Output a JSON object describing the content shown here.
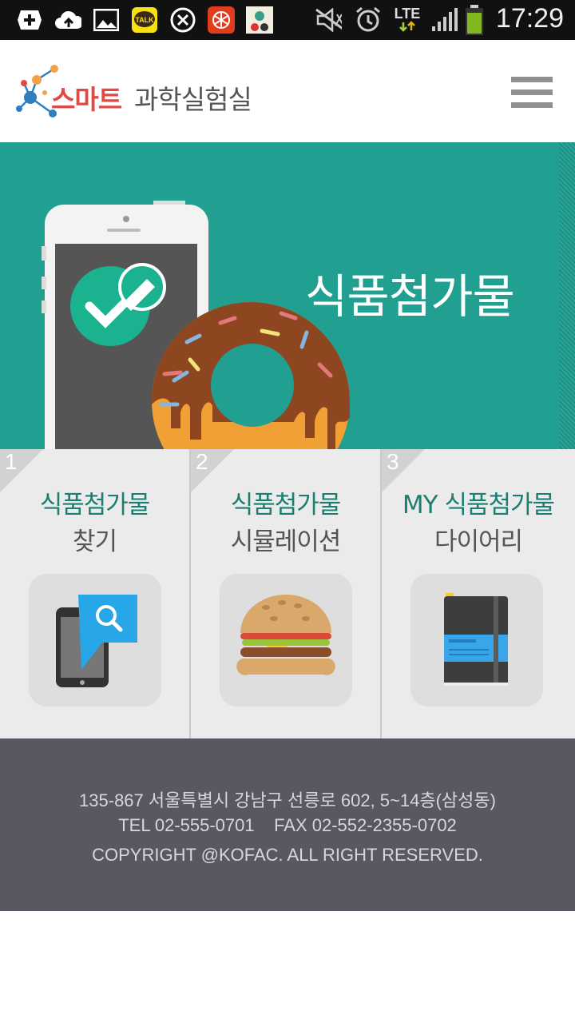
{
  "status_bar": {
    "time": "17:29",
    "network": "LTE",
    "icons": [
      "plus-icon",
      "cloud-upload-icon",
      "image-icon",
      "kakaotalk-icon",
      "x-app-icon",
      "red-app-icon",
      "game-app-icon",
      "mute-icon",
      "alarm-icon",
      "lte-icon",
      "signal-icon",
      "battery-icon"
    ],
    "kakao_label": "TALK"
  },
  "header": {
    "logo_primary": "스마트",
    "logo_secondary": "과학실험실",
    "brand_red": "#e04a45",
    "menu_icon": "hamburger-menu-icon"
  },
  "banner": {
    "title": "식품첨가물",
    "bg_color": "#21a092"
  },
  "tiles": [
    {
      "number": "1",
      "line1": "식품첨가물",
      "line2": "찾기",
      "icon": "phone-search-icon"
    },
    {
      "number": "2",
      "line1": "식품첨가물",
      "line2": "시뮬레이션",
      "icon": "hamburger-food-icon"
    },
    {
      "number": "3",
      "line1": "MY 식품첨가물",
      "line2": "다이어리",
      "icon": "notebook-icon"
    }
  ],
  "footer": {
    "address": "135-867 서울특별시 강남구 선릉로 602, 5~14층(삼성동)",
    "contact": "TEL 02-555-0701    FAX 02-552-2355-0702",
    "copyright": "COPYRIGHT @KOFAC. ALL RIGHT RESERVED."
  },
  "colors": {
    "tile_title": "#1a7f72",
    "footer_bg": "#585862"
  }
}
